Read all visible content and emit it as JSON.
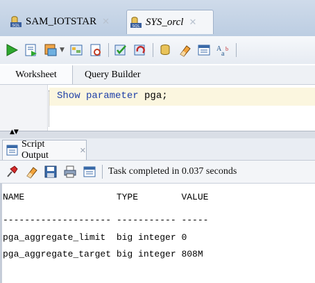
{
  "connection_tabs": [
    {
      "label": "SAM_IOTSTAR",
      "active": false
    },
    {
      "label": "SYS_orcl",
      "active": true
    }
  ],
  "subtabs": {
    "worksheet": "Worksheet",
    "query_builder": "Query Builder"
  },
  "editor": {
    "keyword": "Show parameter",
    "argument": "pga;"
  },
  "output_tab": {
    "label": "Script Output"
  },
  "status": "Task completed in 0.037 seconds",
  "output_lines": [
    "NAME                 TYPE        VALUE",
    "-------------------- ----------- -----",
    "pga_aggregate_limit  big integer 0",
    "pga_aggregate_target big integer 808M"
  ]
}
